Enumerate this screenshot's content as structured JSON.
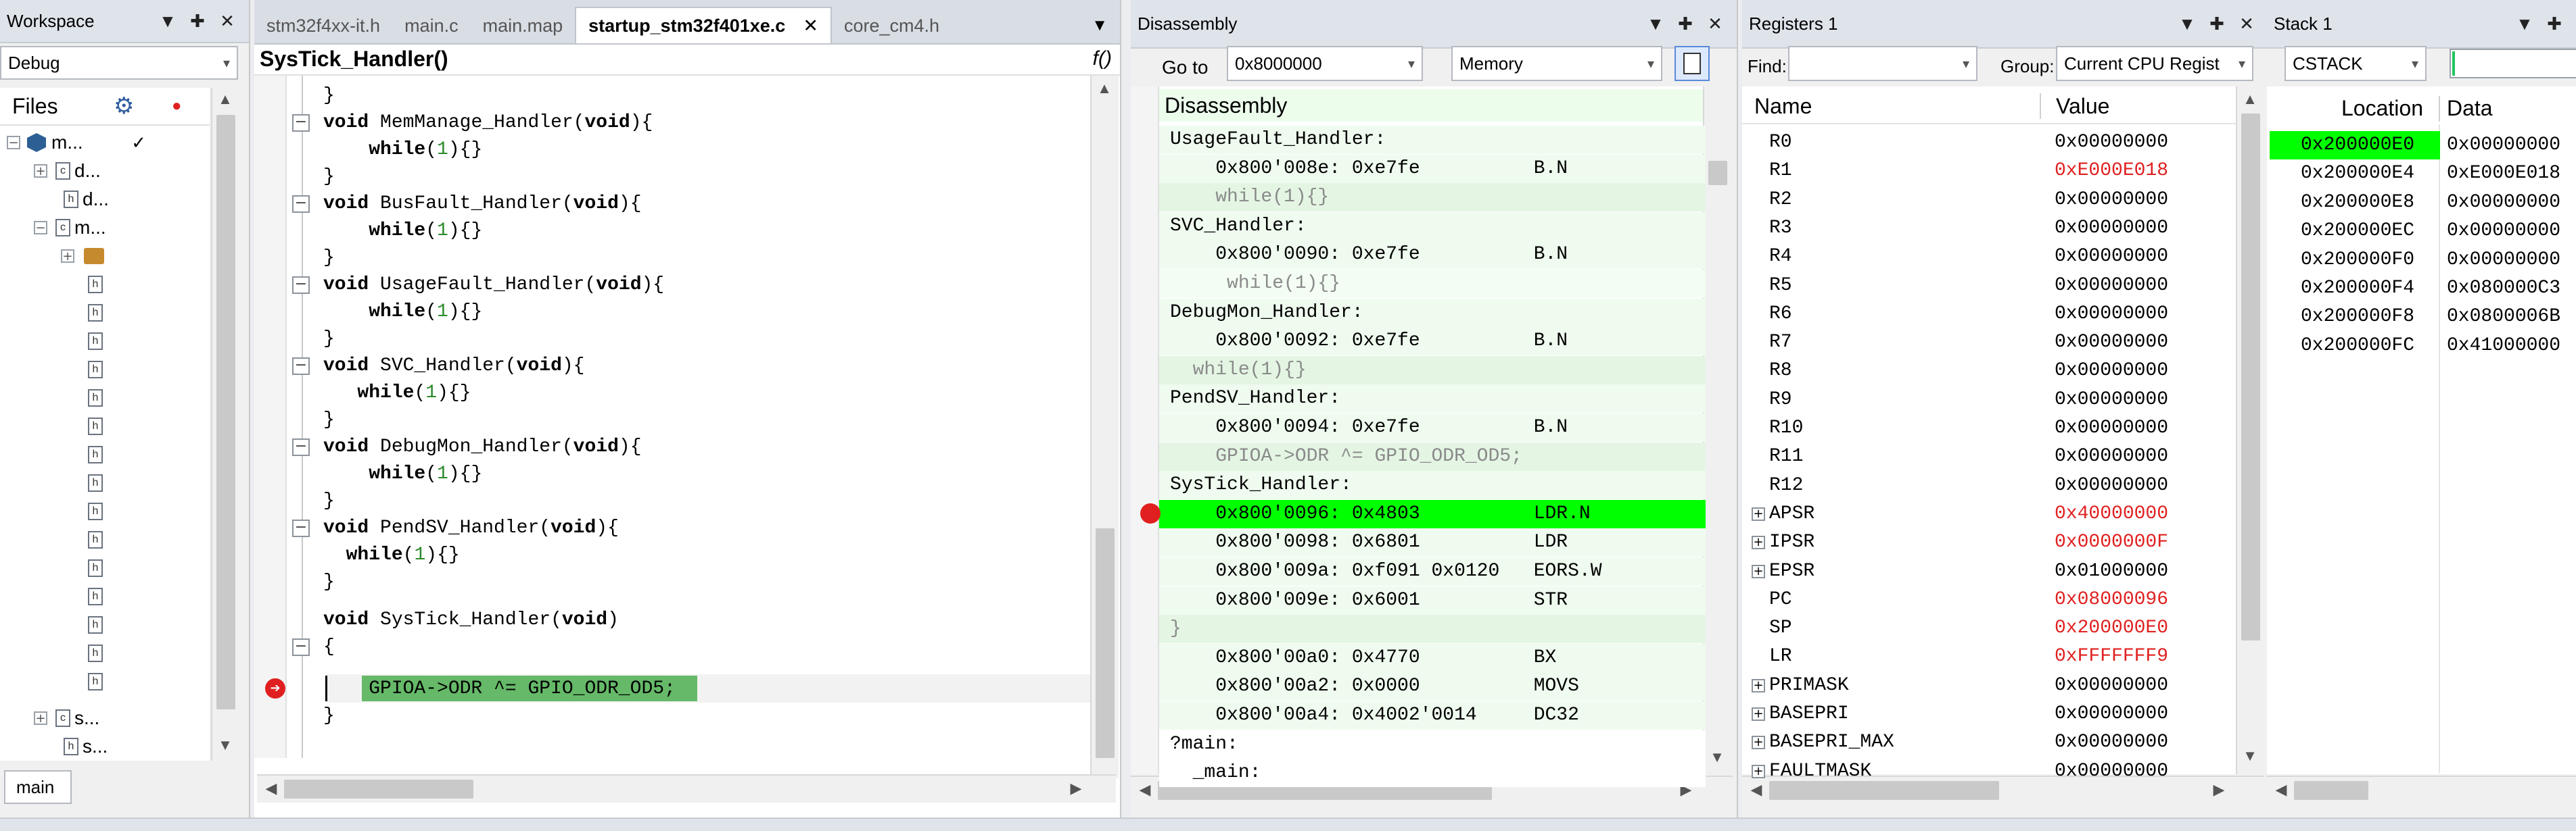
{
  "workspace": {
    "title": "Workspace",
    "config": "Debug",
    "files_label": "Files",
    "bottom_tab": "main",
    "tree": [
      {
        "label": "m..."
      },
      {
        "label": "d..."
      },
      {
        "label": "d..."
      },
      {
        "label": "m..."
      },
      {
        "label": "s..."
      },
      {
        "label": "s..."
      }
    ]
  },
  "editor": {
    "tabs": [
      "stm32f4xx-it.h",
      "main.c",
      "main.map",
      "startup_stm32f401xe.c",
      "core_cm4.h"
    ],
    "active_tab": "startup_stm32f401xe.c",
    "function_label": "SysTick_Handler()",
    "lines": [
      {
        "text": "}"
      },
      {
        "kw": "void",
        "text": " MemManage_Handler(",
        "kw2": "void",
        "end": "){"
      },
      {
        "ws": "    ",
        "kw": "while",
        "num": "1",
        "end": "{}"
      },
      {
        "text": "}"
      },
      {
        "kw": "void",
        "text": " BusFault_Handler(",
        "kw2": "void",
        "end": "){"
      },
      {
        "ws": "    ",
        "kw": "while",
        "num": "1",
        "end": "{}"
      },
      {
        "text": "}"
      },
      {
        "kw": "void",
        "text": " UsageFault_Handler(",
        "kw2": "void",
        "end": "){"
      },
      {
        "ws": "    ",
        "kw": "while",
        "num": "1",
        "end": "{}"
      },
      {
        "text": "}"
      },
      {
        "kw": "void",
        "text": " SVC_Handler(",
        "kw2": "void",
        "end": "){"
      },
      {
        "ws": "   ",
        "kw": "while",
        "num": "1",
        "end": "{}"
      },
      {
        "text": "}"
      },
      {
        "kw": "void",
        "text": " DebugMon_Handler(",
        "kw2": "void",
        "end": "){"
      },
      {
        "ws": "    ",
        "kw": "while",
        "num": "1",
        "end": "{}"
      },
      {
        "text": "}"
      },
      {
        "kw": "void",
        "text": " PendSV_Handler(",
        "kw2": "void",
        "end": "){"
      },
      {
        "ws": "  ",
        "kw": "while",
        "num": "1",
        "end": "{}"
      },
      {
        "text": "}"
      },
      {
        "kw": "void",
        "text": " SysTick_Handler(",
        "kw2": "void",
        "end": ")"
      },
      {
        "text": "{"
      },
      {
        "text": "    GPIOA->ODR ^= GPIO_ODR_OD5;"
      },
      {
        "text": "}"
      }
    ]
  },
  "disassembly": {
    "title": "Disassembly",
    "goto_label": "Go to",
    "goto_value": "0x8000000",
    "memory_label": "Memory",
    "header": "Disassembly",
    "lines": [
      {
        "text": "UsageFault_Handler:"
      },
      {
        "text": "    0x800'008e: 0xe7fe          B.N"
      },
      {
        "text": "    while(1){}"
      },
      {
        "text": "SVC_Handler:"
      },
      {
        "text": "    0x800'0090: 0xe7fe          B.N"
      },
      {
        "text": "     while(1){}"
      },
      {
        "text": "DebugMon_Handler:"
      },
      {
        "text": "    0x800'0092: 0xe7fe          B.N"
      },
      {
        "text": "  while(1){}"
      },
      {
        "text": "PendSV_Handler:"
      },
      {
        "text": "    0x800'0094: 0xe7fe          B.N"
      },
      {
        "text": "    GPIOA->ODR ^= GPIO_ODR_OD5;"
      },
      {
        "text": "SysTick_Handler:"
      },
      {
        "text": "    0x800'0096: 0x4803          LDR.N"
      },
      {
        "text": "    0x800'0098: 0x6801          LDR"
      },
      {
        "text": "    0x800'009a: 0xf091 0x0120   EORS.W"
      },
      {
        "text": "    0x800'009e: 0x6001          STR"
      },
      {
        "text": "}"
      },
      {
        "text": "    0x800'00a0: 0x4770          BX"
      },
      {
        "text": "    0x800'00a2: 0x0000          MOVS"
      },
      {
        "text": "    0x800'00a4: 0x4002'0014     DC32"
      },
      {
        "text": "?main:"
      },
      {
        "text": "  _main:"
      }
    ]
  },
  "registers": {
    "title": "Registers 1",
    "find_label": "Find:",
    "group_label": "Group:",
    "group_value": "Current CPU Regist",
    "col_name": "Name",
    "col_value": "Value",
    "rows": [
      {
        "name": "R0",
        "value": "0x00000000"
      },
      {
        "name": "R1",
        "value": "0xE000E018"
      },
      {
        "name": "R2",
        "value": "0x00000000"
      },
      {
        "name": "R3",
        "value": "0x00000000"
      },
      {
        "name": "R4",
        "value": "0x00000000"
      },
      {
        "name": "R5",
        "value": "0x00000000"
      },
      {
        "name": "R6",
        "value": "0x00000000"
      },
      {
        "name": "R7",
        "value": "0x00000000"
      },
      {
        "name": "R8",
        "value": "0x00000000"
      },
      {
        "name": "R9",
        "value": "0x00000000"
      },
      {
        "name": "R10",
        "value": "0x00000000"
      },
      {
        "name": "R11",
        "value": "0x00000000"
      },
      {
        "name": "R12",
        "value": "0x00000000"
      },
      {
        "name": "APSR",
        "value": "0x40000000"
      },
      {
        "name": "IPSR",
        "value": "0x0000000F"
      },
      {
        "name": "EPSR",
        "value": "0x01000000"
      },
      {
        "name": "PC",
        "value": "0x08000096"
      },
      {
        "name": "SP",
        "value": "0x200000E0"
      },
      {
        "name": "LR",
        "value": "0xFFFFFFF9"
      },
      {
        "name": "PRIMASK",
        "value": "0x00000000"
      },
      {
        "name": "BASEPRI",
        "value": "0x00000000"
      },
      {
        "name": "BASEPRI_MAX",
        "value": "0x00000000"
      },
      {
        "name": "FAULTMASK",
        "value": "0x00000000"
      }
    ]
  },
  "stack": {
    "title": "Stack 1",
    "selector": "CSTACK",
    "col_location": "Location",
    "col_data": "Data",
    "rows": [
      {
        "loc": "0x200000E0",
        "data": "0x00000000"
      },
      {
        "loc": "0x200000E4",
        "data": "0xE000E018"
      },
      {
        "loc": "0x200000E8",
        "data": "0x00000000"
      },
      {
        "loc": "0x200000EC",
        "data": "0x00000000"
      },
      {
        "loc": "0x200000F0",
        "data": "0x00000000"
      },
      {
        "loc": "0x200000F4",
        "data": "0x080000C3"
      },
      {
        "loc": "0x200000F8",
        "data": "0x0800006B"
      },
      {
        "loc": "0x200000FC",
        "data": "0x41000000"
      }
    ]
  },
  "colors": {
    "highlight": "#00ff00",
    "changed_value": "#e02020",
    "breakpoint": "#e02020"
  },
  "icons": [
    "pin-icon",
    "close-icon",
    "dropdown-icon",
    "gear-icon",
    "record-icon",
    "check-icon",
    "breakpoint-icon",
    "pc-arrow-icon",
    "function-icon"
  ]
}
